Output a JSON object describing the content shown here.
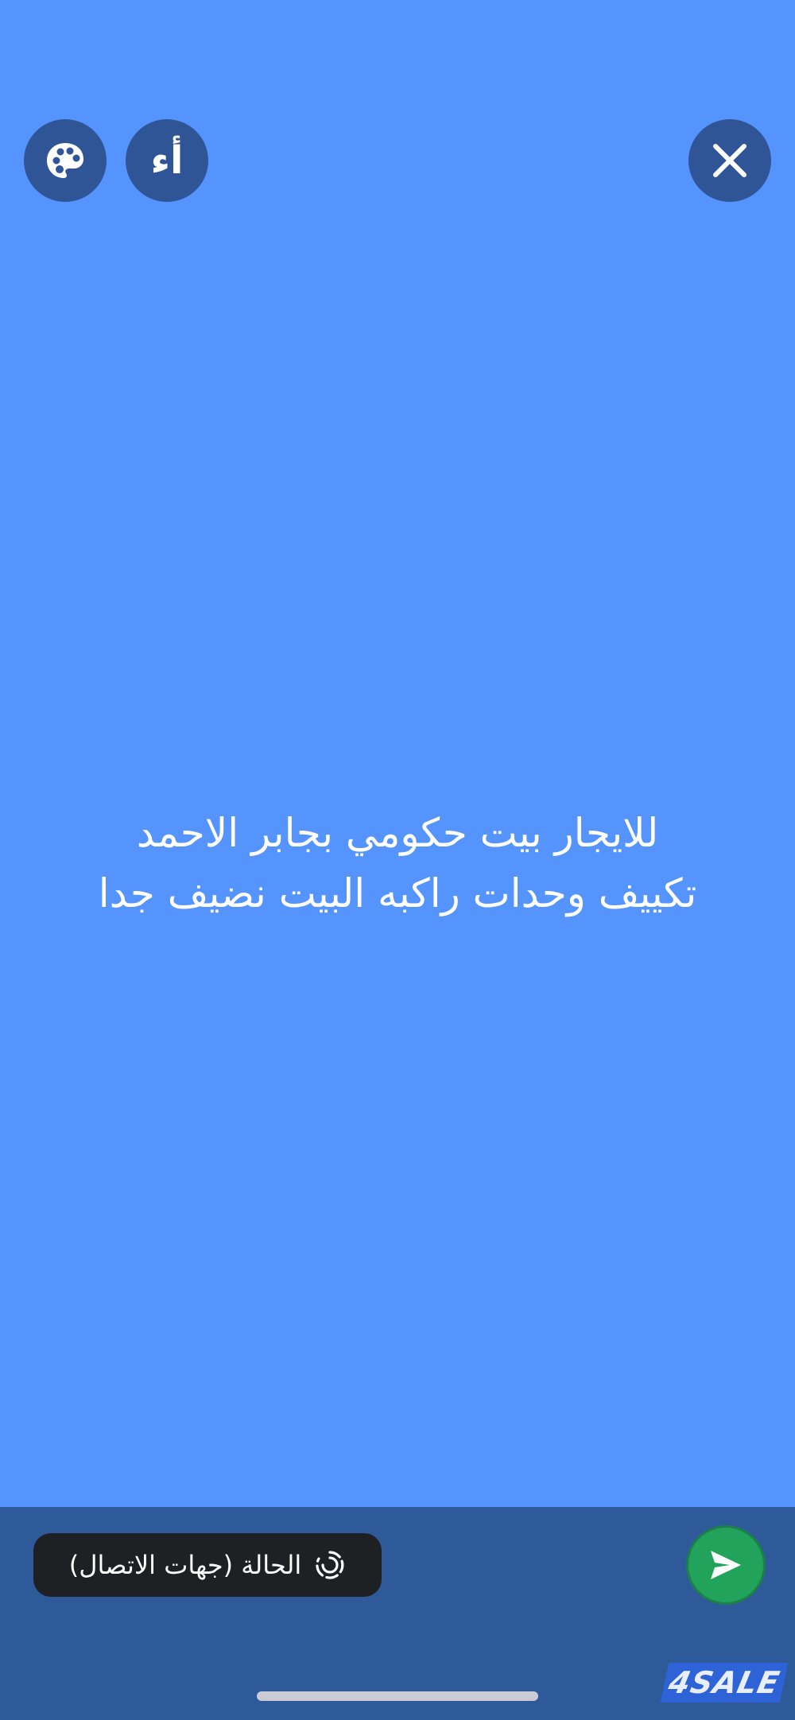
{
  "status_editor": {
    "font_button_glyph": "أء",
    "text_lines": [
      "للايجار بيت حكومي بجابر الاحمد",
      "تكييف وحدات راكبه البيت نضيف جدا"
    ],
    "background_color": "#5594fd"
  },
  "icons": {
    "close": "close-icon",
    "palette": "palette-icon",
    "status": "status-ring-icon",
    "send": "send-icon"
  },
  "bottom_bar": {
    "audience_label": "الحالة (جهات الاتصال)",
    "send_color": "#21a35b"
  },
  "watermark": {
    "text": "4SALE"
  }
}
